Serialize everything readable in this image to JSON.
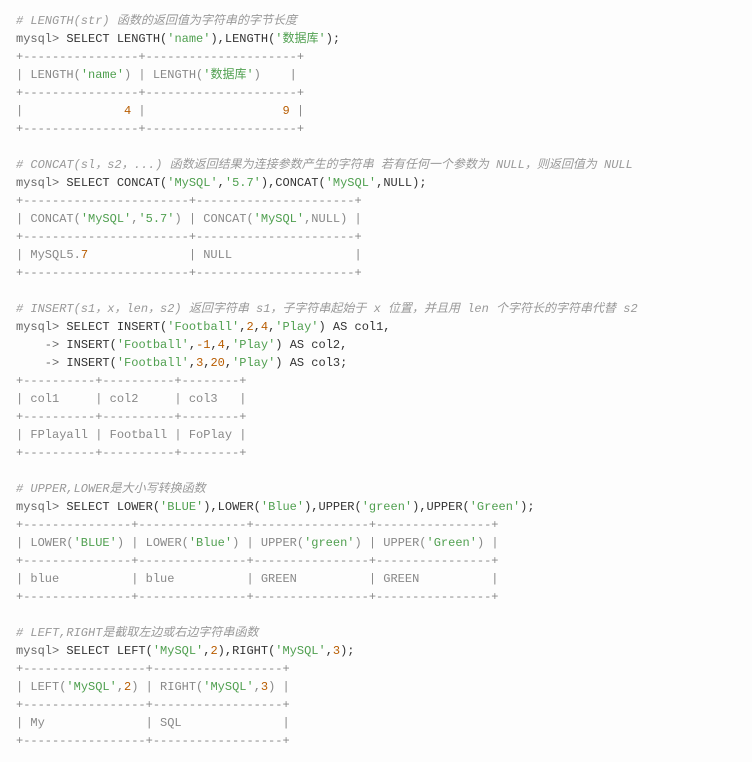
{
  "sections": [
    {
      "comment": "# LENGTH(str) 函数的返回值为字符串的字节长度",
      "query_parts": [
        {
          "t": "prompt",
          "v": "mysql> "
        },
        {
          "t": "keyword",
          "v": "SELECT LENGTH("
        },
        {
          "t": "string",
          "v": "'name'"
        },
        {
          "t": "keyword",
          "v": "),LENGTH("
        },
        {
          "t": "string",
          "v": "'数据库'"
        },
        {
          "t": "keyword",
          "v": ");"
        }
      ],
      "table_lines": [
        "+----------------+---------------------+",
        "| LENGTH('name') | LENGTH('数据库')    |",
        "+----------------+---------------------+",
        "|              4 |                   9 |",
        "+----------------+---------------------+"
      ]
    },
    {
      "comment": "# CONCAT(sl，s2，...) 函数返回结果为连接参数产生的字符串 若有任何一个参数为 NULL，则返回值为 NULL",
      "query_parts": [
        {
          "t": "prompt",
          "v": "mysql> "
        },
        {
          "t": "keyword",
          "v": "SELECT CONCAT("
        },
        {
          "t": "string",
          "v": "'MySQL'"
        },
        {
          "t": "keyword",
          "v": ","
        },
        {
          "t": "string",
          "v": "'5.7'"
        },
        {
          "t": "keyword",
          "v": "),CONCAT("
        },
        {
          "t": "string",
          "v": "'MySQL'"
        },
        {
          "t": "keyword",
          "v": ",NULL);"
        }
      ],
      "table_lines": [
        "+-----------------------+----------------------+",
        "| CONCAT('MySQL','5.7') | CONCAT('MySQL',NULL) |",
        "+-----------------------+----------------------+",
        "| MySQL5.7              | NULL                 |",
        "+-----------------------+----------------------+"
      ]
    },
    {
      "comment": "# INSERT(s1，x，len，s2) 返回字符串 s1，子字符串起始于 x 位置，并且用 len 个字符长的字符串代替 s2",
      "query_parts": [
        {
          "t": "prompt",
          "v": "mysql> "
        },
        {
          "t": "keyword",
          "v": "SELECT INSERT("
        },
        {
          "t": "string",
          "v": "'Football'"
        },
        {
          "t": "keyword",
          "v": ","
        },
        {
          "t": "number",
          "v": "2"
        },
        {
          "t": "keyword",
          "v": ","
        },
        {
          "t": "number",
          "v": "4"
        },
        {
          "t": "keyword",
          "v": ","
        },
        {
          "t": "string",
          "v": "'Play'"
        },
        {
          "t": "keyword",
          "v": ") AS col1,"
        },
        {
          "t": "nl",
          "v": "\n"
        },
        {
          "t": "prompt",
          "v": "    -> "
        },
        {
          "t": "keyword",
          "v": "INSERT("
        },
        {
          "t": "string",
          "v": "'Football'"
        },
        {
          "t": "keyword",
          "v": ","
        },
        {
          "t": "number",
          "v": "-1"
        },
        {
          "t": "keyword",
          "v": ","
        },
        {
          "t": "number",
          "v": "4"
        },
        {
          "t": "keyword",
          "v": ","
        },
        {
          "t": "string",
          "v": "'Play'"
        },
        {
          "t": "keyword",
          "v": ") AS col2,"
        },
        {
          "t": "nl",
          "v": "\n"
        },
        {
          "t": "prompt",
          "v": "    -> "
        },
        {
          "t": "keyword",
          "v": "INSERT("
        },
        {
          "t": "string",
          "v": "'Football'"
        },
        {
          "t": "keyword",
          "v": ","
        },
        {
          "t": "number",
          "v": "3"
        },
        {
          "t": "keyword",
          "v": ","
        },
        {
          "t": "number",
          "v": "20"
        },
        {
          "t": "keyword",
          "v": ","
        },
        {
          "t": "string",
          "v": "'Play'"
        },
        {
          "t": "keyword",
          "v": ") AS col3;"
        }
      ],
      "table_lines": [
        "+----------+----------+--------+",
        "| col1     | col2     | col3   |",
        "+----------+----------+--------+",
        "| FPlayall | Football | FoPlay |",
        "+----------+----------+--------+"
      ]
    },
    {
      "comment": "# UPPER,LOWER是大小写转换函数",
      "query_parts": [
        {
          "t": "prompt",
          "v": "mysql> "
        },
        {
          "t": "keyword",
          "v": "SELECT LOWER("
        },
        {
          "t": "string",
          "v": "'BLUE'"
        },
        {
          "t": "keyword",
          "v": "),LOWER("
        },
        {
          "t": "string",
          "v": "'Blue'"
        },
        {
          "t": "keyword",
          "v": "),UPPER("
        },
        {
          "t": "string",
          "v": "'green'"
        },
        {
          "t": "keyword",
          "v": "),UPPER("
        },
        {
          "t": "string",
          "v": "'Green'"
        },
        {
          "t": "keyword",
          "v": ");"
        }
      ],
      "table_lines": [
        "+---------------+---------------+----------------+----------------+",
        "| LOWER('BLUE') | LOWER('Blue') | UPPER('green') | UPPER('Green') |",
        "+---------------+---------------+----------------+----------------+",
        "| blue          | blue          | GREEN          | GREEN          |",
        "+---------------+---------------+----------------+----------------+"
      ]
    },
    {
      "comment": "# LEFT,RIGHT是截取左边或右边字符串函数",
      "query_parts": [
        {
          "t": "prompt",
          "v": "mysql> "
        },
        {
          "t": "keyword",
          "v": "SELECT LEFT("
        },
        {
          "t": "string",
          "v": "'MySQL'"
        },
        {
          "t": "keyword",
          "v": ","
        },
        {
          "t": "number",
          "v": "2"
        },
        {
          "t": "keyword",
          "v": "),RIGHT("
        },
        {
          "t": "string",
          "v": "'MySQL'"
        },
        {
          "t": "keyword",
          "v": ","
        },
        {
          "t": "number",
          "v": "3"
        },
        {
          "t": "keyword",
          "v": ");"
        }
      ],
      "table_lines": [
        "+-----------------+------------------+",
        "| LEFT('MySQL',2) | RIGHT('MySQL',3) |",
        "+-----------------+------------------+",
        "| My              | SQL              |",
        "+-----------------+------------------+"
      ]
    }
  ]
}
